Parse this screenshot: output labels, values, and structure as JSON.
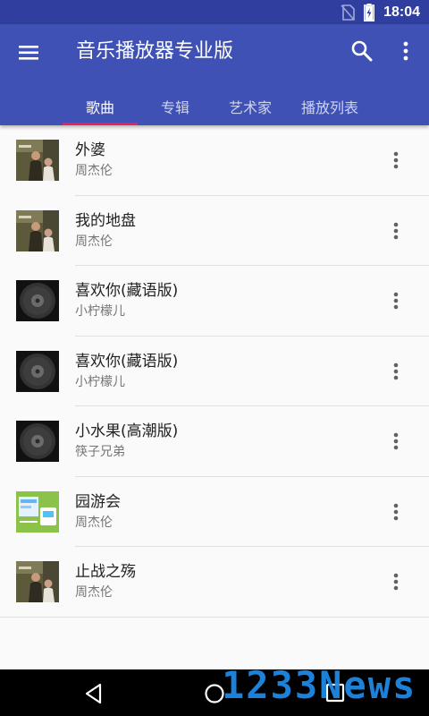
{
  "status_bar": {
    "time": "18:04"
  },
  "app_bar": {
    "title": "音乐播放器专业版"
  },
  "tabs": [
    {
      "label": "歌曲",
      "active": true
    },
    {
      "label": "专辑",
      "active": false
    },
    {
      "label": "艺术家",
      "active": false
    },
    {
      "label": "播放列表",
      "active": false
    }
  ],
  "songs": [
    {
      "title": "外婆",
      "artist": "周杰伦",
      "cover": "album-photo"
    },
    {
      "title": "我的地盘",
      "artist": "周杰伦",
      "cover": "album-photo"
    },
    {
      "title": "喜欢你(藏语版)",
      "artist": "小柠檬儿",
      "cover": "default-disc"
    },
    {
      "title": "喜欢你(藏语版)",
      "artist": "小柠檬儿",
      "cover": "default-disc"
    },
    {
      "title": "小水果(高潮版)",
      "artist": "筷子兄弟",
      "cover": "default-disc"
    },
    {
      "title": "园游会",
      "artist": "周杰伦",
      "cover": "green-cover"
    },
    {
      "title": "止战之殇",
      "artist": "周杰伦",
      "cover": "album-photo"
    }
  ],
  "watermark": {
    "text": "1233News"
  },
  "colors": {
    "primary": "#3f51b5",
    "primary_dark": "#303f9f",
    "accent": "#e91e63"
  }
}
